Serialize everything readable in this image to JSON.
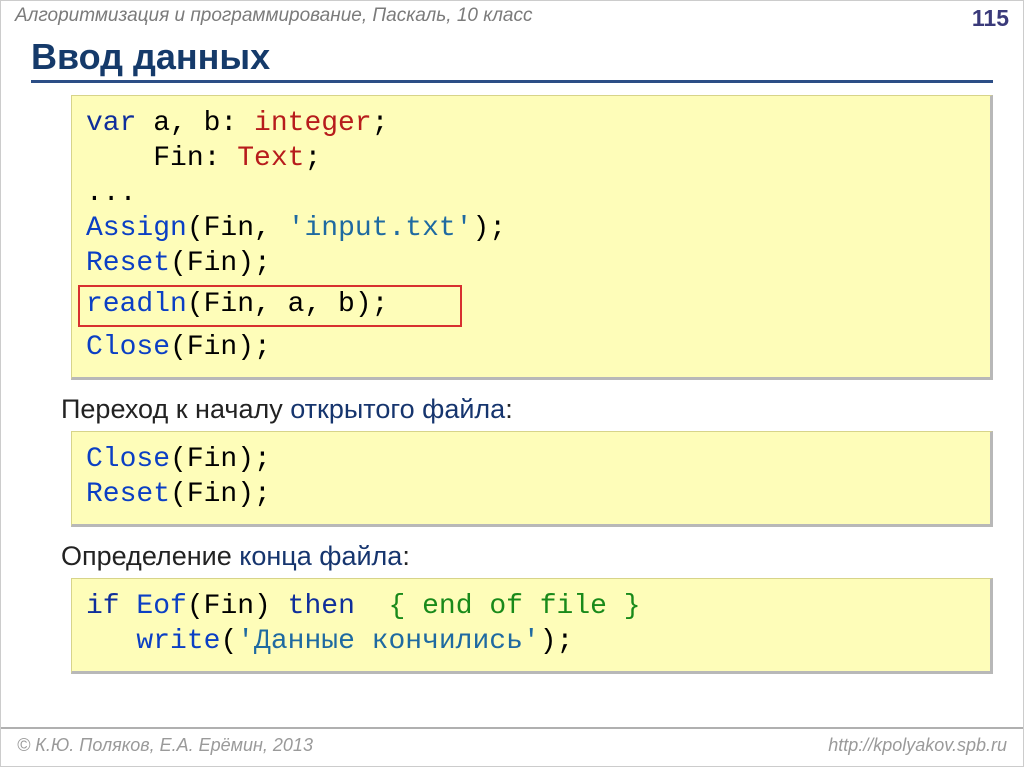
{
  "header": {
    "course": "Алгоритмизация и программирование, Паскаль, 10 класс",
    "page": "115"
  },
  "title": "Ввод данных",
  "code1": {
    "l1": {
      "kw": "var",
      "vars": " a, b: ",
      "type": "integer",
      "end": ";"
    },
    "l2": {
      "pad": "    ",
      "id": "Fin: ",
      "type": "Text",
      "end": ";"
    },
    "l3": {
      "dots": "..."
    },
    "l4": {
      "fn": "Assign",
      "args_a": "(Fin, ",
      "str": "'input.txt'",
      "args_b": ");"
    },
    "l5": {
      "fn": "Reset",
      "args": "(Fin);"
    },
    "l6": {
      "fn": "readln",
      "args": "(Fin, a, b);"
    },
    "l7": {
      "fn": "Close",
      "args": "(Fin);"
    }
  },
  "sub1": {
    "text": "Переход к началу ",
    "hl": "открытого файла",
    "colon": ":"
  },
  "code2": {
    "l1": {
      "fn": "Close",
      "args": "(Fin);"
    },
    "l2": {
      "fn": "Reset",
      "args": "(Fin);"
    }
  },
  "sub2": {
    "text": "Определение ",
    "hl": "конца файла",
    "colon": ":"
  },
  "code3": {
    "l1": {
      "if": "if",
      "sp1": " ",
      "fn": "Eof",
      "args": "(Fin) ",
      "then": "then",
      "sp2": "  ",
      "comment": "{ end of file }"
    },
    "l2": {
      "pad": "   ",
      "fn": "write",
      "args_a": "(",
      "str": "'Данные кончились'",
      "args_b": ");"
    }
  },
  "footer": {
    "left": "© К.Ю. Поляков, Е.А. Ерёмин, 2013",
    "right": "http://kpolyakov.spb.ru"
  }
}
